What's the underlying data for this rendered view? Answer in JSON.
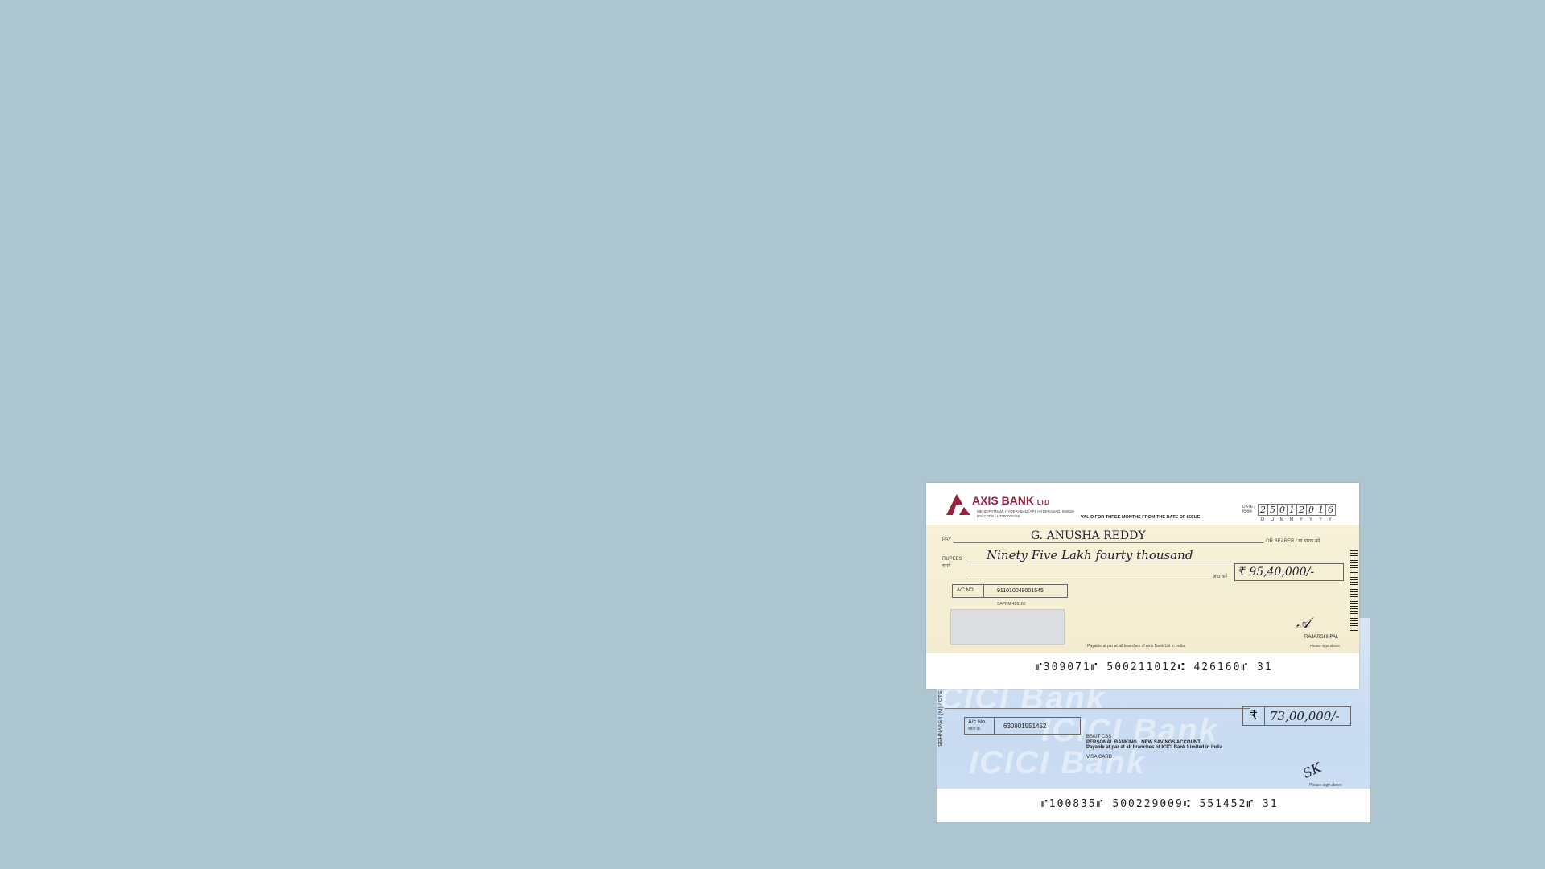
{
  "axis_cheque": {
    "bank_name": "AXIS BANK",
    "bank_suffix": "LTD",
    "branch_address": "MEHDIPATNAM, HYDERABAD [AP], HYDERABAD, 500028",
    "ifs_code": "IFS CODE - UTIB0000426",
    "validity": "VALID FOR THREE MONTHS FROM THE DATE OF ISSUE",
    "date_label": "DATE / दिनांक",
    "date_digits": [
      "2",
      "5",
      "0",
      "1",
      "2",
      "0",
      "1",
      "6"
    ],
    "date_format": [
      "D",
      "D",
      "M",
      "M",
      "Y",
      "Y",
      "Y",
      "Y"
    ],
    "pay_label": "PAY",
    "payee": "G. ANUSHA REDDY",
    "bearer_label": "OR BEARER / या धारक को",
    "rupees_label": "RUPEES",
    "rupees_hindi": "रुपये",
    "amount_words": "Ninety Five Lakh fourty thousand",
    "ada_karen": "अदा करें",
    "amount": "₹  95,40,000/-",
    "ac_label": "A/C NO.",
    "ac_number": "911010049001545",
    "sub_code": "SAPPM    426160",
    "payable_note": "Payable at par at all branches of Axis Bank Ltd in India.",
    "signatory": "RAJARSHI PAL",
    "sign_note": "Please sign above",
    "micr": "⑈309071⑈  500211012⑆  426160⑈  31",
    "brand_color": "#97233f"
  },
  "icici_cheque": {
    "watermark": "ICICI Bank",
    "amount": "73,00,000/-",
    "rupee_symbol": "₹",
    "ac_label": "A/c No.",
    "ac_label_hindi": "खाता क्र.",
    "ac_number": "630801551452",
    "product_codes": "BSKIT           CBS",
    "account_type": "PERSONAL BANKING : NEW SAVINGS ACCOUNT",
    "payable_note": "Payable at par at all branches of ICICI Bank Limited in India",
    "card": "VISA CARD",
    "sign_note": "Please sign above",
    "side_text": "SEHNAAS4 (M) / CTS",
    "micr": "⑈100835⑈  500229009⑆  551452⑈  31"
  }
}
